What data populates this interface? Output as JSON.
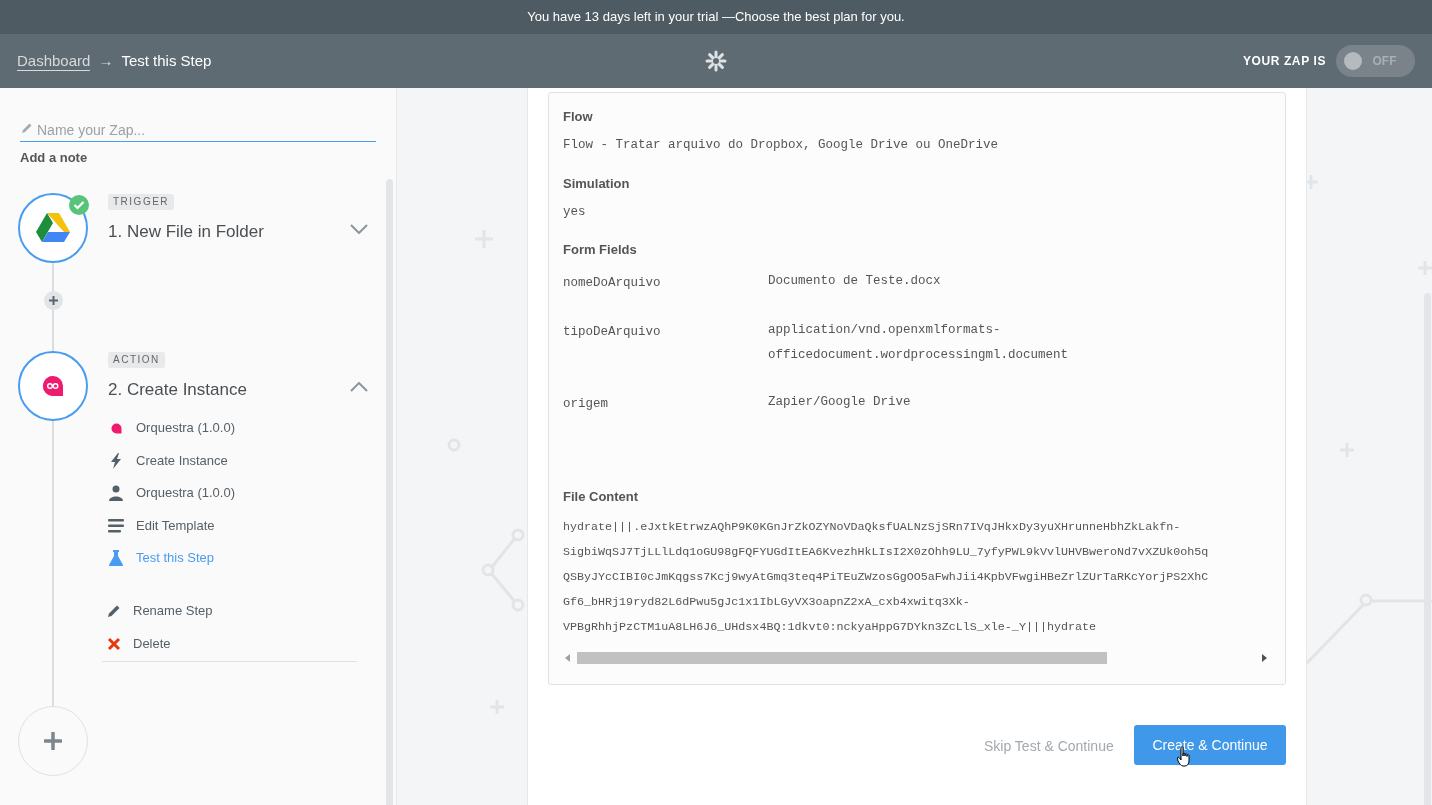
{
  "trial_banner": {
    "text": "You have 13 days left in your trial —Choose the best plan for you."
  },
  "header": {
    "breadcrumb": [
      {
        "label": "Dashboard",
        "kind": "link"
      },
      {
        "label": "Test this Step",
        "kind": "current"
      }
    ],
    "separator": "→",
    "zap_status": {
      "label": "YOUR ZAP IS",
      "on": false,
      "text": "OFF"
    }
  },
  "sidebar": {
    "name_field": {
      "placeholder": "Name your Zap..."
    },
    "add_note": "Add a note",
    "steps": [
      {
        "badge": "TRIGGER",
        "title": "1. New File in Folder",
        "completed": true,
        "expanded": false
      },
      {
        "badge": "ACTION",
        "title": "2. Create Instance",
        "completed": false,
        "expanded": true,
        "items": [
          {
            "label": "Orquestra (1.0.0)",
            "selected": false
          },
          {
            "label": "Create Instance",
            "selected": false
          },
          {
            "label": "Orquestra (1.0.0)",
            "selected": false
          },
          {
            "label": "Edit Template",
            "selected": false
          },
          {
            "label": "Test this Step",
            "selected": true
          }
        ],
        "actions": [
          {
            "label": "Rename Step"
          },
          {
            "label": "Delete"
          }
        ]
      }
    ]
  },
  "result": {
    "fields": [
      {
        "label": "Flow",
        "value": "Flow - Tratar arquivo do Dropbox, Google Drive ou OneDrive"
      },
      {
        "label": "Simulation",
        "value": "yes"
      }
    ],
    "form_fields": {
      "label": "Form Fields",
      "rows": [
        {
          "key": "nomeDoArquivo",
          "value_lines": [
            "Documento de Teste.docx"
          ]
        },
        {
          "key": "tipoDeArquivo",
          "value_lines": [
            "application/vnd.openxmlformats-",
            "officedocument.wordprocessingml.document"
          ]
        },
        {
          "key": "origem",
          "value_lines": [
            "Zapier/Google Drive"
          ]
        }
      ]
    },
    "file_content": {
      "label": "File Content",
      "lines": [
        "hydrate|||.eJxtkEtrwzAQhP9K0KGnJrZkOZYNoVDaQksfUALNzSjSRn7IVqJHkxDy3yuXHrunneHbhZkLakfn-",
        "SigbiWqSJ7TjLLlLdq1oGU98gFQFYUGdItEA6KvezhHkLIsI2X0zOhh9LU_7yfyPWL9kVvlUHVBweroNd7vXZUk0oh5q",
        "QSByJYcCIBI0cJmKqgss7Kcj9wyAtGmq3teq4PiTEuZWzosGgOO5aFwhJii4KpbVFwgiHBeZrlZUrTaRKcYorjPS2XhC",
        "Gf6_bHRj19ryd82L6dPwu5gJc1x1IbLGyVX3oapnZ2xA_cxb4xwitq3Xk-",
        "VPBgRhhjPzCTM1uA8LH6J6_UHdsx4BQ:1dkvt0:nckyaHppG7DYkn3ZcLlS_xle-_Y|||hydrate"
      ]
    }
  },
  "buttons": {
    "skip": "Skip Test & Continue",
    "primary": "Create & Continue"
  }
}
